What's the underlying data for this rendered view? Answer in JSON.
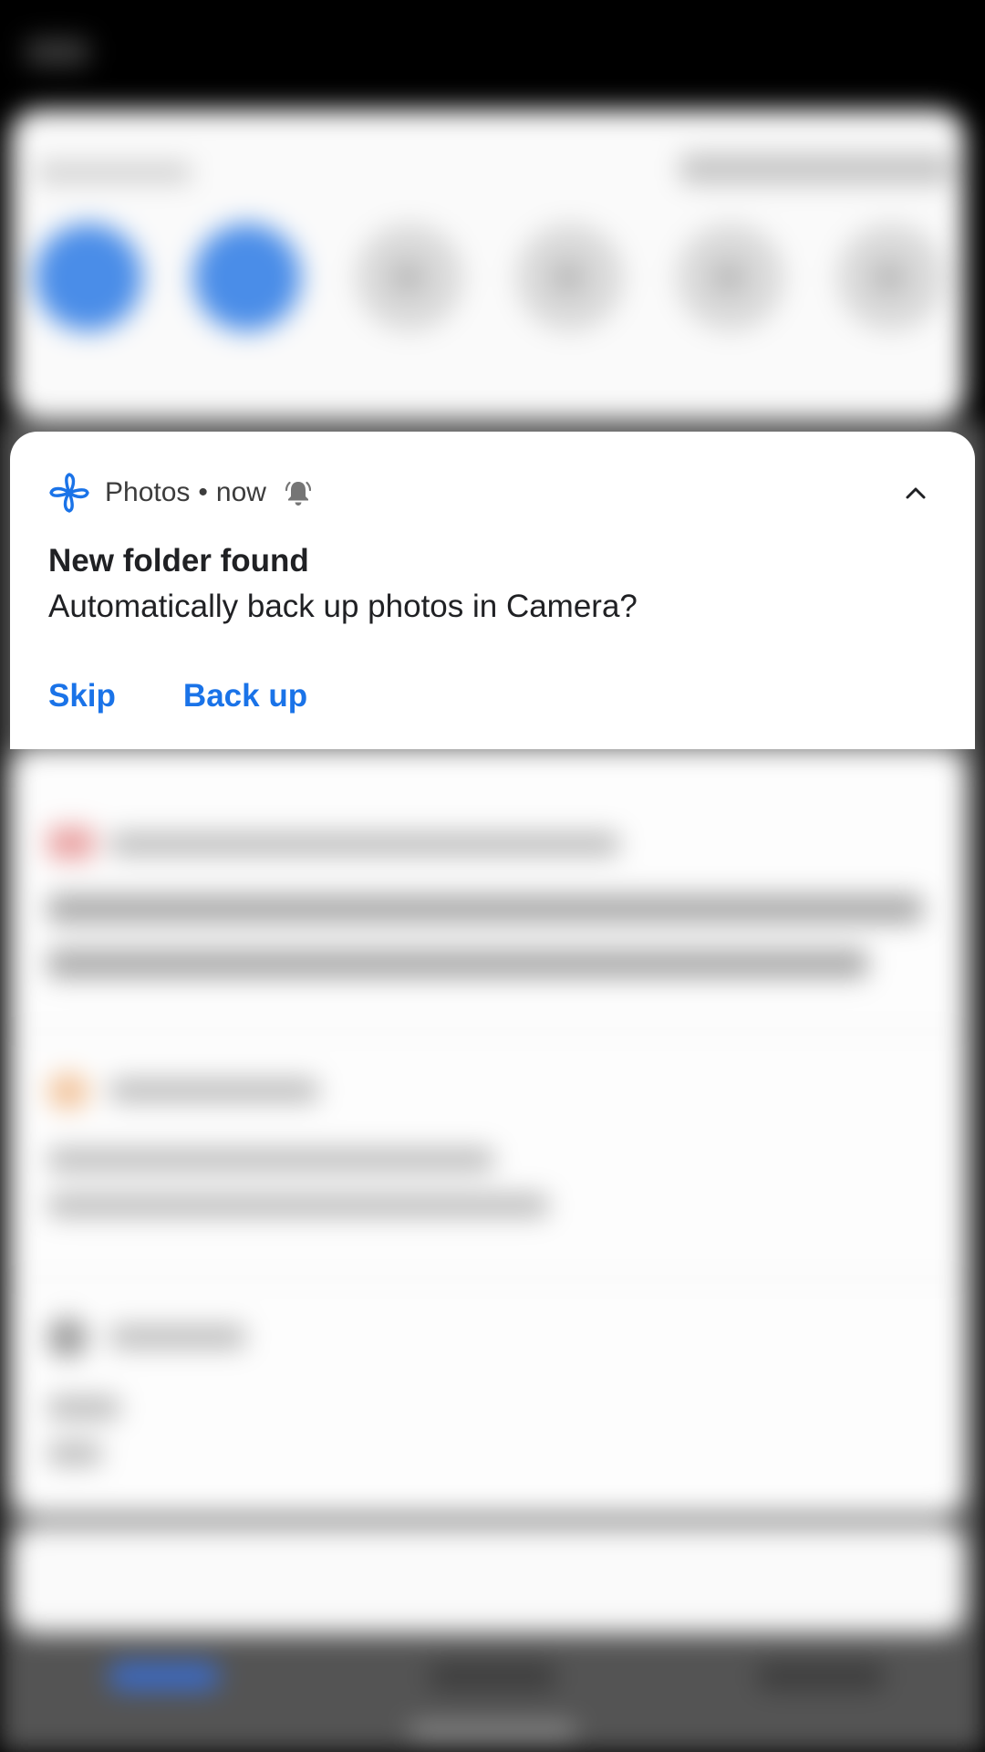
{
  "notification": {
    "app_name": "Photos",
    "separator": "•",
    "time": "now",
    "title": "New folder found",
    "body": "Automatically back up photos in Camera?",
    "actions": {
      "skip_label": "Skip",
      "backup_label": "Back up"
    },
    "icons": {
      "app": "photos-pinwheel-icon",
      "alert": "bell-icon",
      "expand": "chevron-up-icon"
    }
  },
  "colors": {
    "accent": "#1a73e8",
    "text_primary": "#202124",
    "text_secondary": "#3c3c3c",
    "card": "#ffffff",
    "scrim": "#000000"
  }
}
